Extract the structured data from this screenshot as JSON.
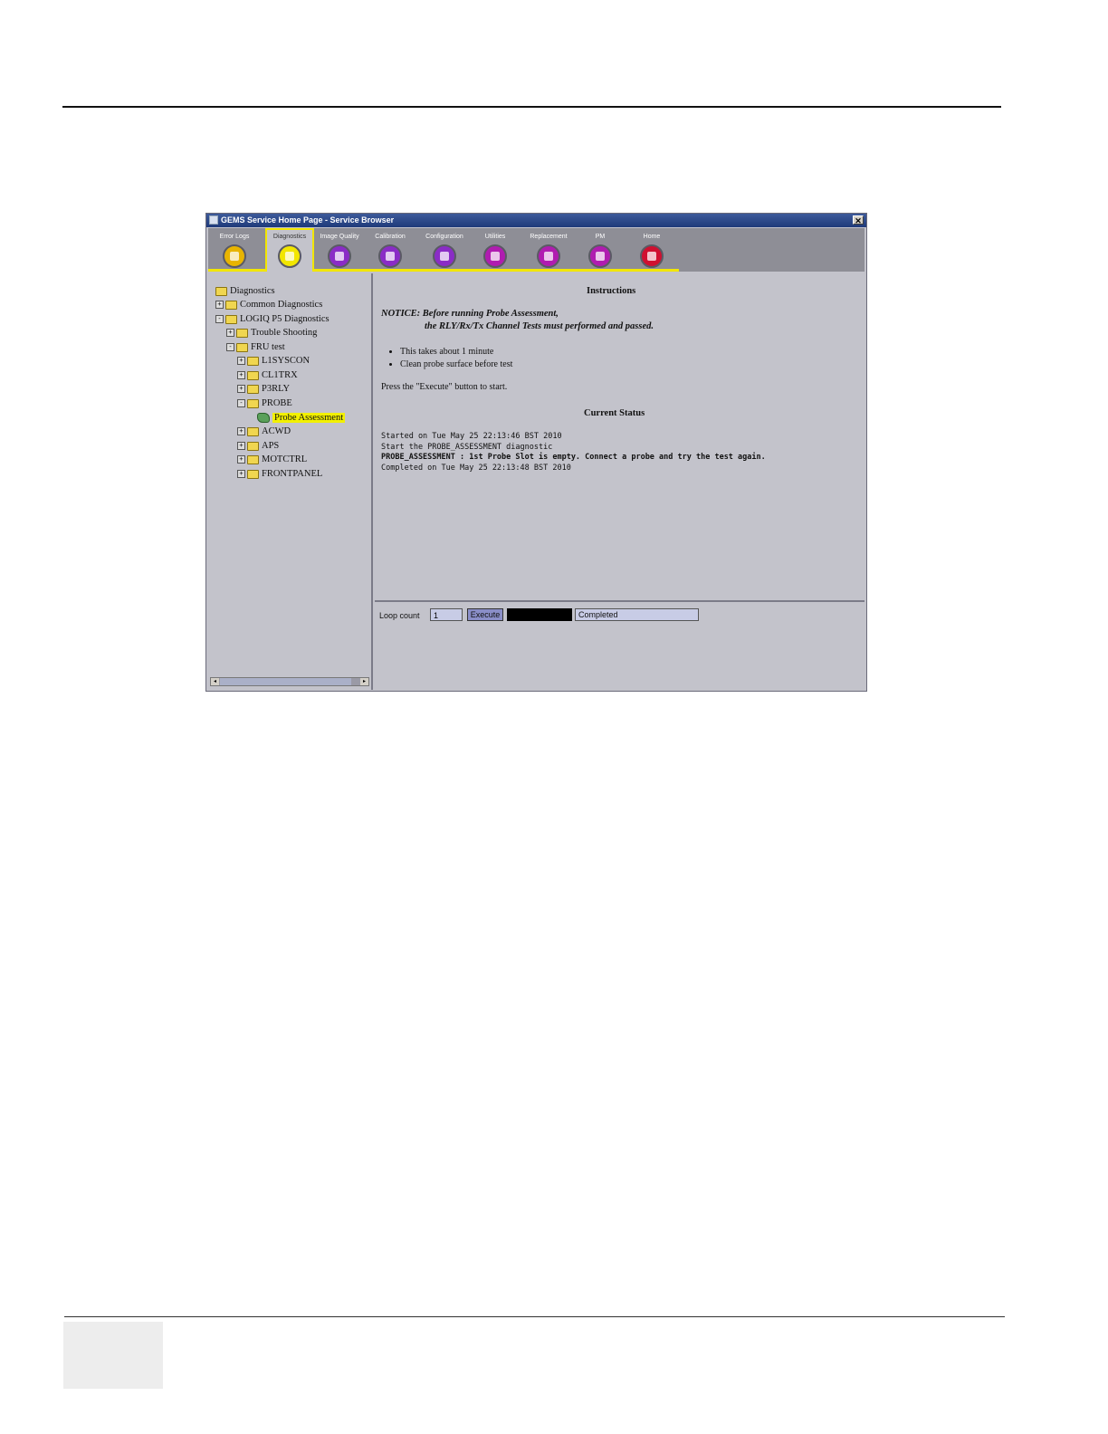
{
  "window": {
    "title": "GEMS Service Home Page - Service Browser",
    "close_glyph": "✕"
  },
  "toolbar": {
    "tabs": [
      {
        "label": "Error Logs",
        "color": "#e8b400"
      },
      {
        "label": "Diagnostics",
        "color": "#f2e600"
      },
      {
        "label": "Image Quality",
        "color": "#8a2cc6"
      },
      {
        "label": "Calibration",
        "color": "#8a2cc6"
      },
      {
        "label": "Configuration",
        "color": "#8a2cc6"
      },
      {
        "label": "Utilities",
        "color": "#b01cb0"
      },
      {
        "label": "Replacement",
        "color": "#b01cb0"
      },
      {
        "label": "PM",
        "color": "#b01cb0"
      },
      {
        "label": "Home",
        "color": "#d01030"
      }
    ],
    "active_index": 1
  },
  "tree": {
    "items": [
      {
        "label": "Diagnostics"
      },
      {
        "label": "Common Diagnostics",
        "exp": "+"
      },
      {
        "label": "LOGIQ P5 Diagnostics",
        "exp": "-"
      },
      {
        "label": "Trouble Shooting",
        "exp": "+"
      },
      {
        "label": "FRU test",
        "exp": "-"
      },
      {
        "label": "L1SYSCON",
        "exp": "+"
      },
      {
        "label": "CL1TRX",
        "exp": "+"
      },
      {
        "label": "P3RLY",
        "exp": "+"
      },
      {
        "label": "PROBE",
        "exp": "-"
      },
      {
        "label": "Probe Assessment"
      },
      {
        "label": "ACWD",
        "exp": "+"
      },
      {
        "label": "APS",
        "exp": "+"
      },
      {
        "label": "MOTCTRL",
        "exp": "+"
      },
      {
        "label": "FRONTPANEL",
        "exp": "+"
      }
    ],
    "selected": "Probe Assessment",
    "scroll_left": "◂",
    "scroll_right": "▸"
  },
  "instructions": {
    "heading": "Instructions",
    "notice_line1": "NOTICE: Before running Probe Assessment,",
    "notice_line2": "the RLY/Rx/Tx Channel Tests must performed and passed.",
    "bullets": [
      "This takes about 1 minute",
      "Clean probe surface before test"
    ],
    "press_text": "Press the \"Execute\" button to start."
  },
  "current_status": {
    "heading": "Current Status",
    "lines": [
      "Started on Tue May 25 22:13:46 BST 2010",
      "Start the PROBE_ASSESSMENT diagnostic",
      "PROBE_ASSESSMENT : 1st Probe Slot is empty. Connect a probe and try the test again.",
      "Completed on Tue May 25 22:13:48 BST 2010"
    ]
  },
  "controls": {
    "loop_count_label": "Loop count",
    "loop_count_value": "1",
    "execute_label": "Execute",
    "status_value": "Completed"
  }
}
